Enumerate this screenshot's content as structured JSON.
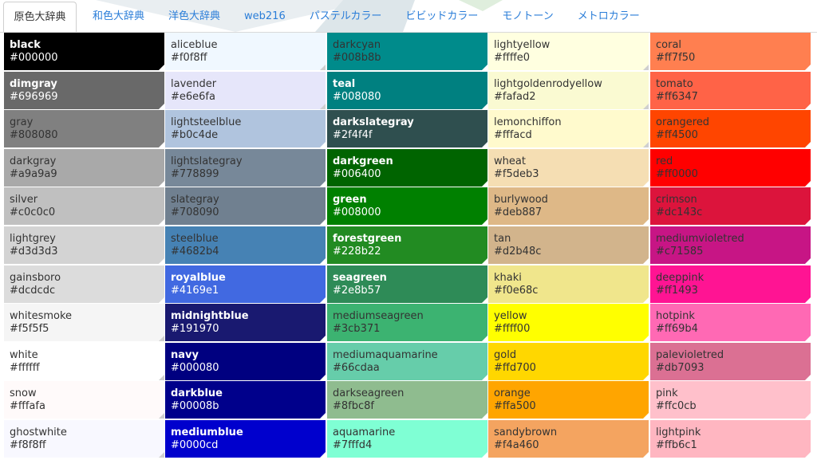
{
  "tabs": [
    {
      "label": "原色大辞典",
      "active": true
    },
    {
      "label": "和色大辞典",
      "active": false
    },
    {
      "label": "洋色大辞典",
      "active": false
    },
    {
      "label": "web216",
      "active": false
    },
    {
      "label": "パステルカラー",
      "active": false
    },
    {
      "label": "ビビッドカラー",
      "active": false
    },
    {
      "label": "モノトーン",
      "active": false
    },
    {
      "label": "メトロカラー",
      "active": false
    }
  ],
  "columns": [
    [
      {
        "name": "black",
        "hex": "#000000",
        "text": "light"
      },
      {
        "name": "dimgray",
        "hex": "#696969",
        "text": "light"
      },
      {
        "name": "gray",
        "hex": "#808080",
        "text": "dark"
      },
      {
        "name": "darkgray",
        "hex": "#a9a9a9",
        "text": "dark"
      },
      {
        "name": "silver",
        "hex": "#c0c0c0",
        "text": "dark"
      },
      {
        "name": "lightgrey",
        "hex": "#d3d3d3",
        "text": "dark"
      },
      {
        "name": "gainsboro",
        "hex": "#dcdcdc",
        "text": "dark"
      },
      {
        "name": "whitesmoke",
        "hex": "#f5f5f5",
        "text": "dark"
      },
      {
        "name": "white",
        "hex": "#ffffff",
        "text": "dark"
      },
      {
        "name": "snow",
        "hex": "#fffafa",
        "text": "dark"
      },
      {
        "name": "ghostwhite",
        "hex": "#f8f8ff",
        "text": "dark"
      }
    ],
    [
      {
        "name": "aliceblue",
        "hex": "#f0f8ff",
        "text": "dark"
      },
      {
        "name": "lavender",
        "hex": "#e6e6fa",
        "text": "dark"
      },
      {
        "name": "lightsteelblue",
        "hex": "#b0c4de",
        "text": "dark"
      },
      {
        "name": "lightslategray",
        "hex": "#778899",
        "text": "dark"
      },
      {
        "name": "slategray",
        "hex": "#708090",
        "text": "dark"
      },
      {
        "name": "steelblue",
        "hex": "#4682b4",
        "text": "dark"
      },
      {
        "name": "royalblue",
        "hex": "#4169e1",
        "text": "light"
      },
      {
        "name": "midnightblue",
        "hex": "#191970",
        "text": "light"
      },
      {
        "name": "navy",
        "hex": "#000080",
        "text": "light"
      },
      {
        "name": "darkblue",
        "hex": "#00008b",
        "text": "light"
      },
      {
        "name": "mediumblue",
        "hex": "#0000cd",
        "text": "light"
      }
    ],
    [
      {
        "name": "darkcyan",
        "hex": "#008b8b",
        "text": "dark"
      },
      {
        "name": "teal",
        "hex": "#008080",
        "text": "light"
      },
      {
        "name": "darkslategray",
        "hex": "#2f4f4f",
        "text": "light"
      },
      {
        "name": "darkgreen",
        "hex": "#006400",
        "text": "light"
      },
      {
        "name": "green",
        "hex": "#008000",
        "text": "light"
      },
      {
        "name": "forestgreen",
        "hex": "#228b22",
        "text": "light"
      },
      {
        "name": "seagreen",
        "hex": "#2e8b57",
        "text": "light"
      },
      {
        "name": "mediumseagreen",
        "hex": "#3cb371",
        "text": "dark"
      },
      {
        "name": "mediumaquamarine",
        "hex": "#66cdaa",
        "text": "dark"
      },
      {
        "name": "darkseagreen",
        "hex": "#8fbc8f",
        "text": "dark"
      },
      {
        "name": "aquamarine",
        "hex": "#7fffd4",
        "text": "dark"
      }
    ],
    [
      {
        "name": "lightyellow",
        "hex": "#ffffe0",
        "text": "dark"
      },
      {
        "name": "lightgoldenrodyellow",
        "hex": "#fafad2",
        "text": "dark"
      },
      {
        "name": "lemonchiffon",
        "hex": "#fffacd",
        "text": "dark"
      },
      {
        "name": "wheat",
        "hex": "#f5deb3",
        "text": "dark"
      },
      {
        "name": "burlywood",
        "hex": "#deb887",
        "text": "dark"
      },
      {
        "name": "tan",
        "hex": "#d2b48c",
        "text": "dark"
      },
      {
        "name": "khaki",
        "hex": "#f0e68c",
        "text": "dark"
      },
      {
        "name": "yellow",
        "hex": "#ffff00",
        "text": "dark"
      },
      {
        "name": "gold",
        "hex": "#ffd700",
        "text": "dark"
      },
      {
        "name": "orange",
        "hex": "#ffa500",
        "text": "dark"
      },
      {
        "name": "sandybrown",
        "hex": "#f4a460",
        "text": "dark"
      }
    ],
    [
      {
        "name": "coral",
        "hex": "#ff7f50",
        "text": "dark"
      },
      {
        "name": "tomato",
        "hex": "#ff6347",
        "text": "dark"
      },
      {
        "name": "orangered",
        "hex": "#ff4500",
        "text": "dark"
      },
      {
        "name": "red",
        "hex": "#ff0000",
        "text": "dark"
      },
      {
        "name": "crimson",
        "hex": "#dc143c",
        "text": "dark"
      },
      {
        "name": "mediumvioletred",
        "hex": "#c71585",
        "text": "dark"
      },
      {
        "name": "deeppink",
        "hex": "#ff1493",
        "text": "dark"
      },
      {
        "name": "hotpink",
        "hex": "#ff69b4",
        "text": "dark"
      },
      {
        "name": "palevioletred",
        "hex": "#db7093",
        "text": "dark"
      },
      {
        "name": "pink",
        "hex": "#ffc0cb",
        "text": "dark"
      },
      {
        "name": "lightpink",
        "hex": "#ffb6c1",
        "text": "dark"
      }
    ]
  ]
}
